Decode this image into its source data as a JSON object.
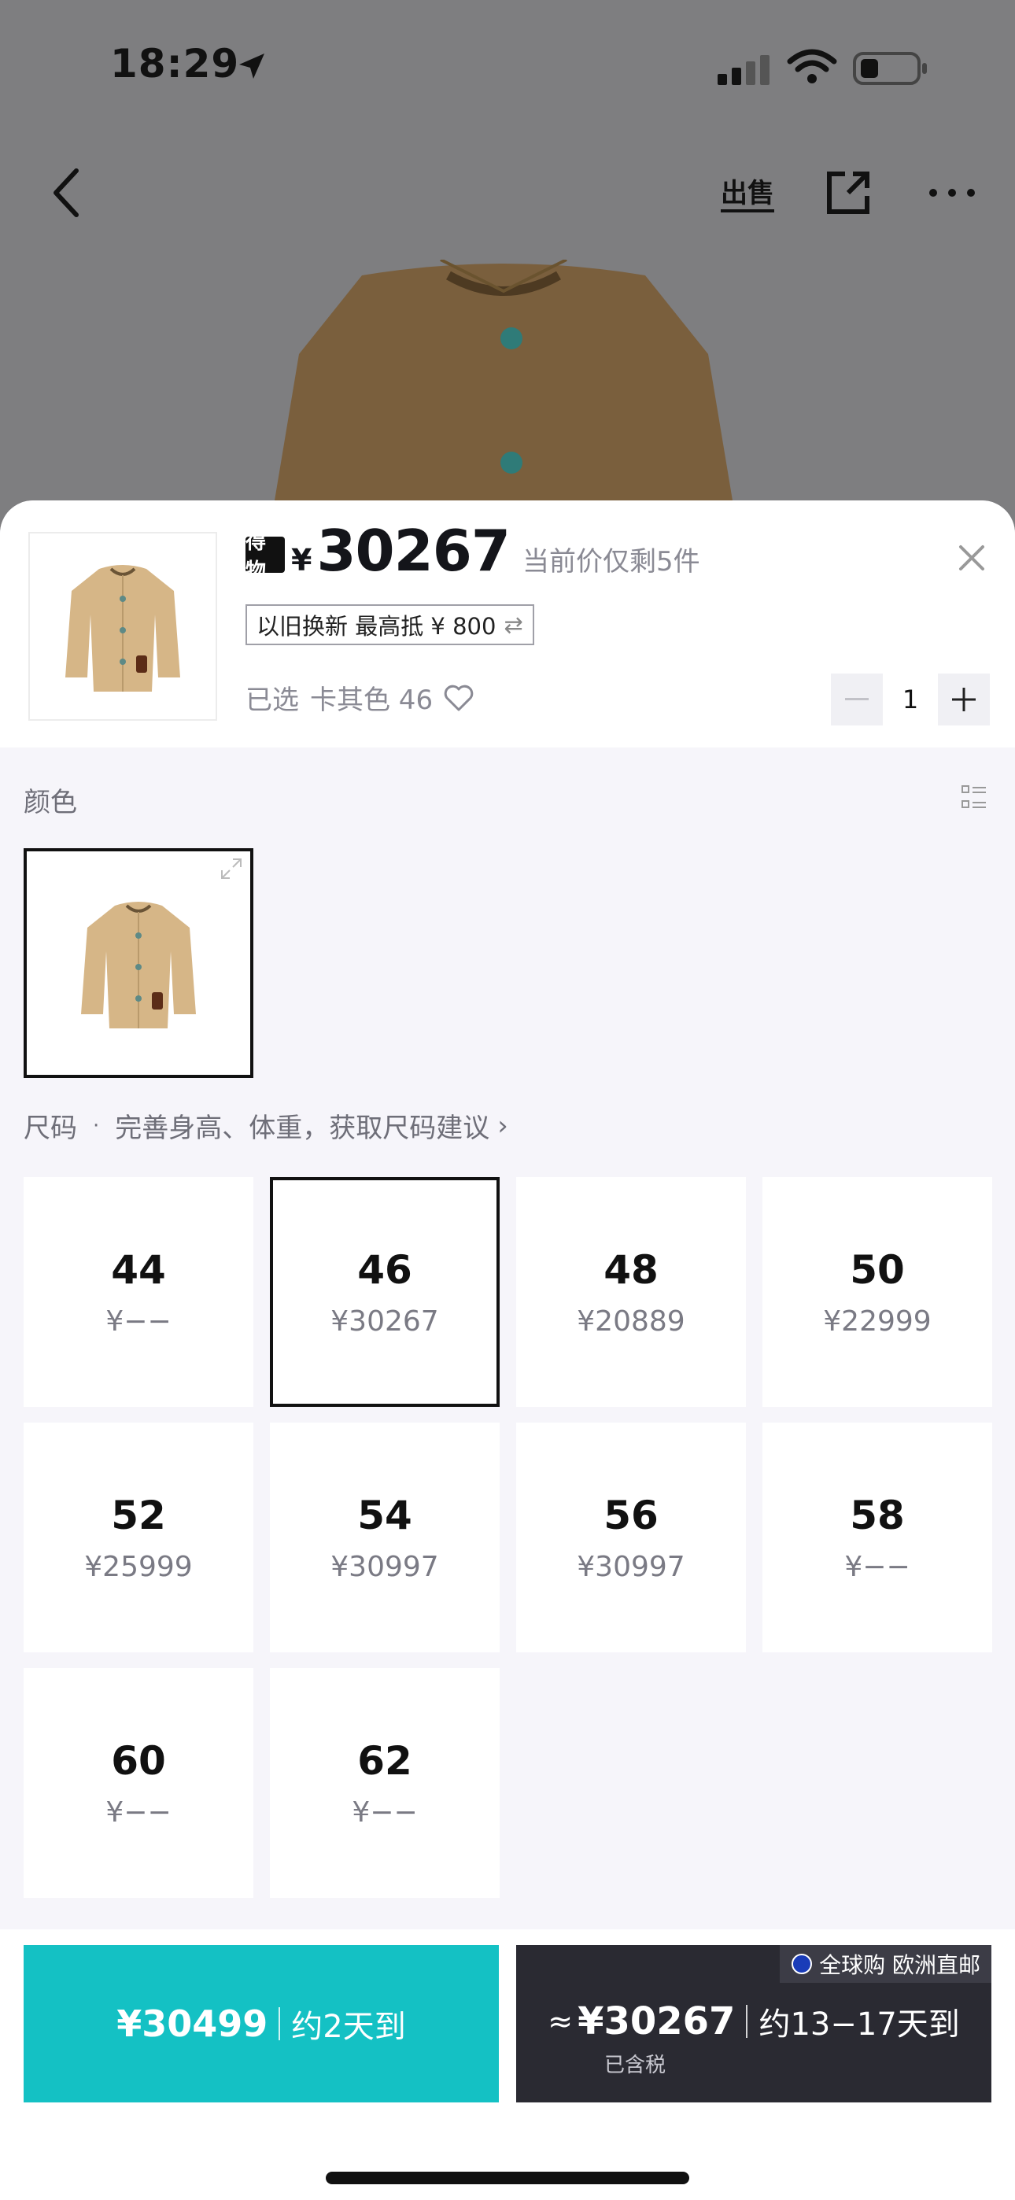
{
  "status_bar": {
    "time": "18:29"
  },
  "nav": {
    "sell_label": "出售"
  },
  "product": {
    "brand_logo_text": "得物",
    "currency": "¥",
    "price": "30267",
    "stock_note": "当前价仅剩5件",
    "tradein_text": "以旧换新 最高抵 ¥ 800",
    "tradein_arrow": "⇄",
    "selected_prefix": "已选",
    "selected_value": "卡其色 46",
    "quantity": "1"
  },
  "color_section": {
    "label": "颜色"
  },
  "size_section": {
    "label": "尺码",
    "dot": "·",
    "hint": "完善身高、体重，获取尺码建议",
    "hint_chevron": "›",
    "sizes": [
      {
        "size": "44",
        "price": "¥−−"
      },
      {
        "size": "46",
        "price": "¥30267",
        "selected": true
      },
      {
        "size": "48",
        "price": "¥20889"
      },
      {
        "size": "50",
        "price": "¥22999"
      },
      {
        "size": "52",
        "price": "¥25999"
      },
      {
        "size": "54",
        "price": "¥30997"
      },
      {
        "size": "56",
        "price": "¥30997"
      },
      {
        "size": "58",
        "price": "¥−−"
      },
      {
        "size": "60",
        "price": "¥−−"
      },
      {
        "size": "62",
        "price": "¥−−"
      }
    ]
  },
  "bottom": {
    "option1": {
      "price": "¥30499",
      "eta": "约2天到"
    },
    "option2": {
      "tag": "全球购 欧洲直邮",
      "approx": "≈",
      "price": "¥30267",
      "eta": "约13−17天到",
      "tax_note": "已含税"
    }
  },
  "colors": {
    "accent_teal": "#14c1c4",
    "dark_button": "#2a2a32",
    "khaki": "#d6b687"
  },
  "icons": [
    "location-arrow-icon",
    "signal-icon",
    "wifi-icon",
    "battery-icon",
    "back-chevron-icon",
    "share-icon",
    "more-icon",
    "close-icon",
    "heart-icon",
    "list-view-icon",
    "expand-icon",
    "eu-flag-icon"
  ]
}
